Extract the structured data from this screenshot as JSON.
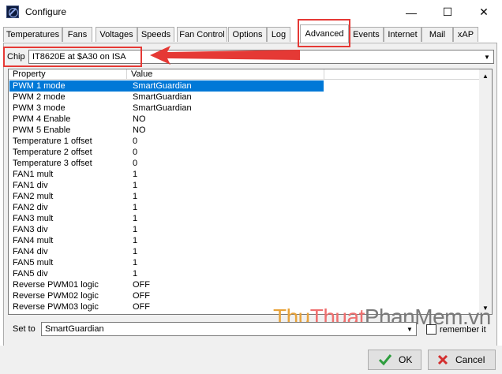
{
  "window": {
    "title": "Configure",
    "minimize": "—",
    "maximize": "☐",
    "close": "✕"
  },
  "tabs": [
    {
      "label": "Temperatures"
    },
    {
      "label": "Fans"
    },
    {
      "label": "Voltages"
    },
    {
      "label": "Speeds"
    },
    {
      "label": "Fan Control"
    },
    {
      "label": "Options"
    },
    {
      "label": "Log"
    },
    {
      "label": "Advanced",
      "active": true
    },
    {
      "label": "Events"
    },
    {
      "label": "Internet"
    },
    {
      "label": "Mail"
    },
    {
      "label": "xAP"
    }
  ],
  "chip": {
    "label": "Chip",
    "value": "IT8620E at $A30 on ISA"
  },
  "table": {
    "headers": [
      "Property",
      "Value"
    ],
    "rows": [
      {
        "property": "PWM 1 mode",
        "value": "SmartGuardian",
        "selected": true
      },
      {
        "property": "PWM 2 mode",
        "value": "SmartGuardian"
      },
      {
        "property": "PWM 3 mode",
        "value": "SmartGuardian"
      },
      {
        "property": "PWM 4 Enable",
        "value": "NO"
      },
      {
        "property": "PWM 5 Enable",
        "value": "NO"
      },
      {
        "property": "Temperature 1 offset",
        "value": "0"
      },
      {
        "property": "Temperature 2 offset",
        "value": "0"
      },
      {
        "property": "Temperature 3 offset",
        "value": "0"
      },
      {
        "property": "FAN1 mult",
        "value": "1"
      },
      {
        "property": "FAN1 div",
        "value": "1"
      },
      {
        "property": "FAN2 mult",
        "value": "1"
      },
      {
        "property": "FAN2 div",
        "value": "1"
      },
      {
        "property": "FAN3 mult",
        "value": "1"
      },
      {
        "property": "FAN3 div",
        "value": "1"
      },
      {
        "property": "FAN4 mult",
        "value": "1"
      },
      {
        "property": "FAN4 div",
        "value": "1"
      },
      {
        "property": "FAN5 mult",
        "value": "1"
      },
      {
        "property": "FAN5 div",
        "value": "1"
      },
      {
        "property": "Reverse PWM01 logic",
        "value": "OFF"
      },
      {
        "property": "Reverse PWM02 logic",
        "value": "OFF"
      },
      {
        "property": "Reverse PWM03 logic",
        "value": "OFF"
      }
    ]
  },
  "set_to": {
    "label": "Set to",
    "value": "SmartGuardian",
    "remember_label": "remember it"
  },
  "watermark": {
    "part1": "Thu",
    "part2": "Thuat",
    "part3": "PhanMem.vn"
  },
  "buttons": {
    "ok": "OK",
    "cancel": "Cancel"
  },
  "colors": {
    "selection": "#0078d7",
    "highlight": "#e53935",
    "ok_check": "#2e9e3e",
    "cancel_x": "#d32f2f"
  }
}
